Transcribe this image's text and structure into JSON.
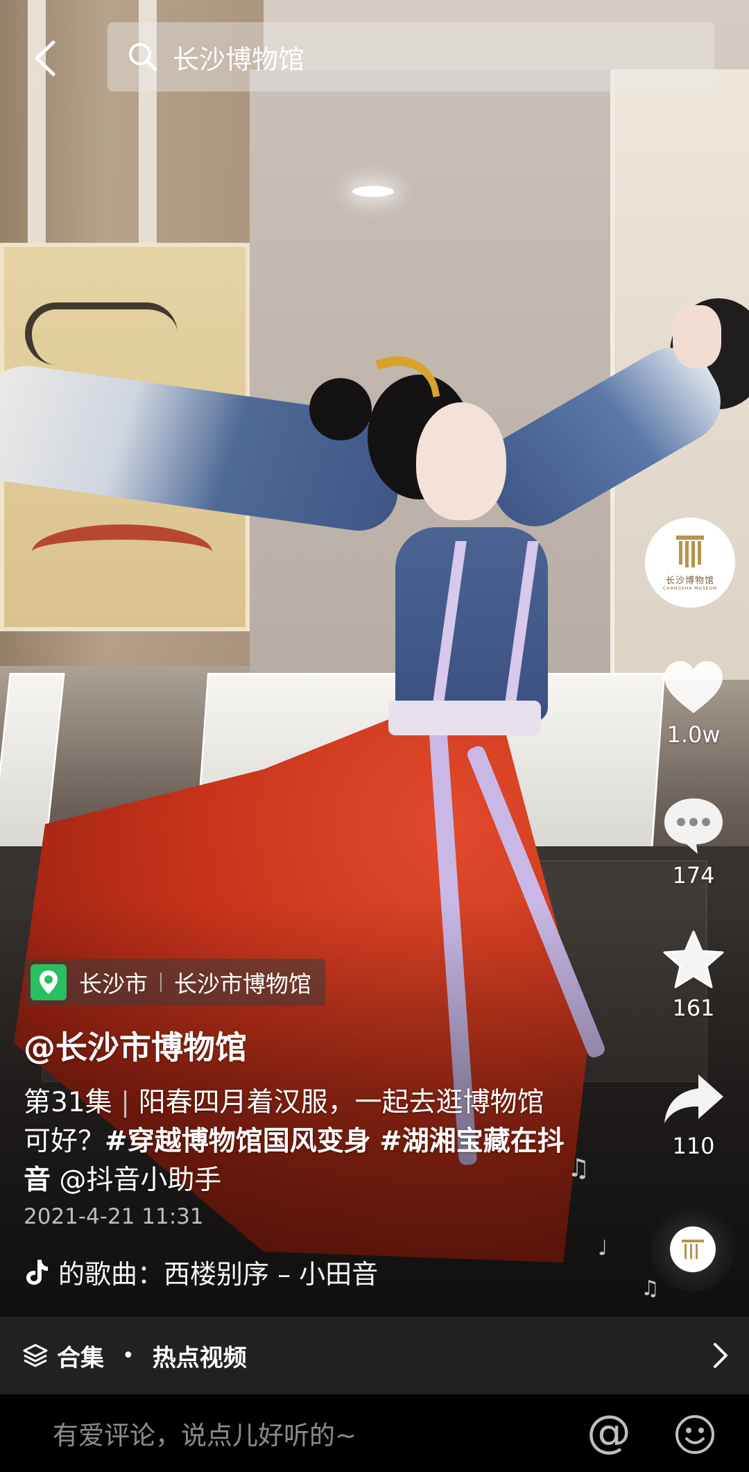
{
  "search": {
    "query": "长沙博物馆"
  },
  "author": {
    "avatar_brand": "长沙博物馆",
    "avatar_brand_en": "CHANGSHA MUSEUM",
    "handle": "@长沙市博物馆"
  },
  "location": {
    "city": "长沙市",
    "place": "长沙市博物馆"
  },
  "description": {
    "episode": "第31集",
    "pipe": "|",
    "text": "阳春四月着汉服，一起去逛博物馆可好？",
    "tag1": "#穿越博物馆国风变身",
    "tag2": "#湖湘宝藏在抖音",
    "mention": "@抖音小助手"
  },
  "date": "2021-4-21 11:31",
  "music": {
    "text": "的歌曲：西楼别序 – 小田音"
  },
  "actions": {
    "likes": "1.0w",
    "comments": "174",
    "favorites": "161",
    "shares": "110"
  },
  "collection": {
    "label": "合集",
    "dot": "•",
    "title": "热点视频"
  },
  "comment_bar": {
    "placeholder": "有爱评论，说点儿好听的~",
    "at": "@"
  },
  "colors": {
    "location_pin": "#28c061",
    "skirt_red": "#c8341b",
    "robe_blue": "#3e5686"
  }
}
